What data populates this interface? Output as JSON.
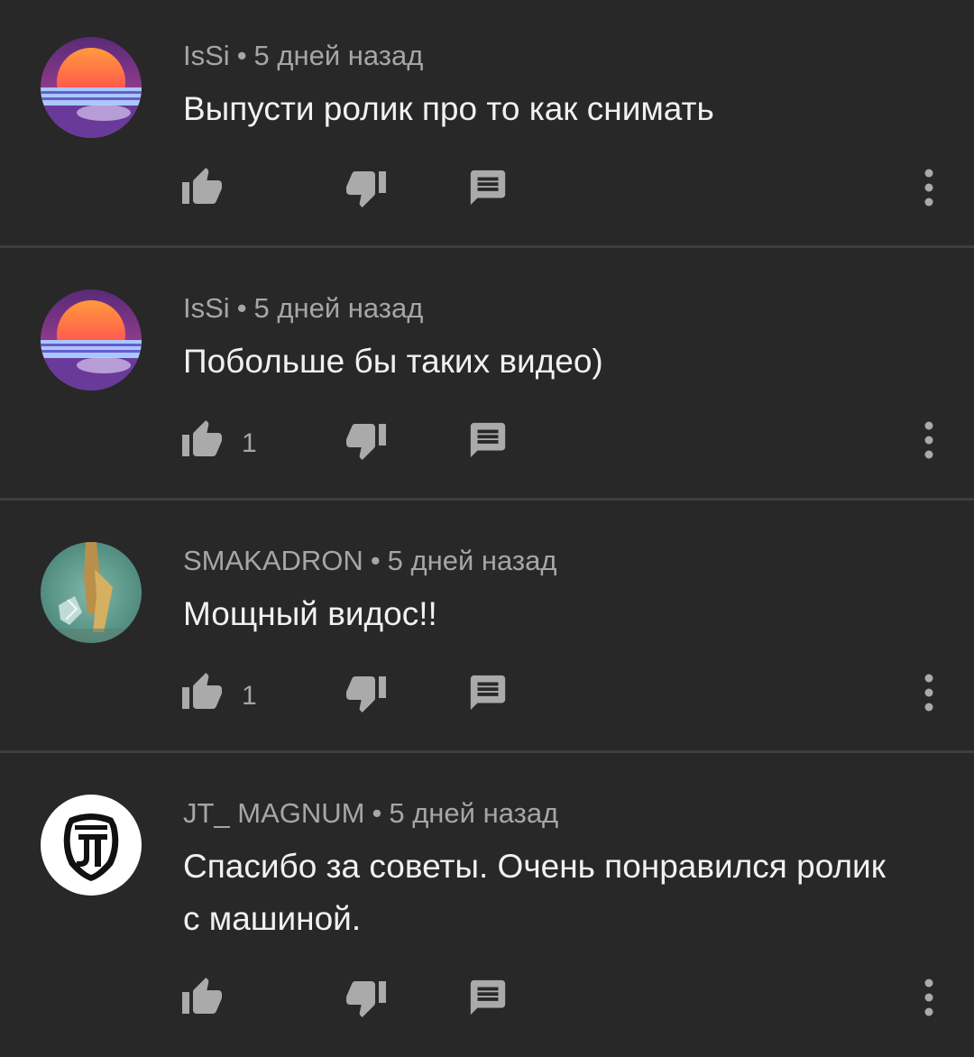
{
  "comments": [
    {
      "author": "IsSi",
      "time": "5 дней назад",
      "text": "Выпусти ролик про то как снимать",
      "likes": "",
      "avatar": "synthwave-sunset-avatar"
    },
    {
      "author": "IsSi",
      "time": "5 дней назад",
      "text": "Побольше бы таких видео)",
      "likes": "1",
      "avatar": "synthwave-sunset-avatar"
    },
    {
      "author": "SMAKADRON",
      "time": "5 дней назад",
      "text": "Мощный видос!!",
      "likes": "1",
      "avatar": "photo-avatar"
    },
    {
      "author": "JT_ MAGNUM",
      "time": "5 дней назад",
      "text": "Спасибо за советы. Очень понравился ролик с машиной.",
      "likes": "",
      "avatar": "jt-magnum-badge-avatar"
    }
  ],
  "meta_separator": "•",
  "colors": {
    "background": "#282828",
    "divider": "#3e3e3e",
    "primary_text": "#f1f1f1",
    "secondary_text": "#a6a6a6",
    "icon": "#aaaaaa"
  },
  "icons": {
    "like": "thumb-up-icon",
    "dislike": "thumb-down-icon",
    "reply": "reply-comment-icon",
    "more": "more-vert-icon"
  }
}
